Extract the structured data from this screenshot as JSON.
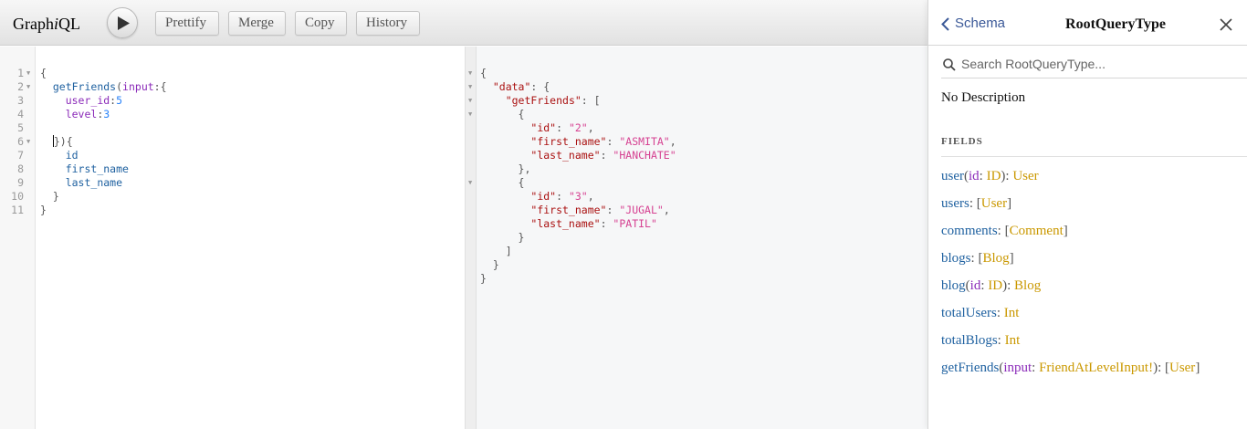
{
  "toolbar": {
    "title_prefix": "Graph",
    "title_italic": "i",
    "title_suffix": "QL",
    "run_icon": "play-icon",
    "buttons": [
      "Prettify",
      "Merge",
      "Copy",
      "History"
    ]
  },
  "query_editor": {
    "line_numbers": [
      "1",
      "2",
      "3",
      "4",
      "5",
      "6",
      "7",
      "8",
      "9",
      "10",
      "11"
    ],
    "lines": [
      {
        "indent": "",
        "tokens": [
          {
            "t": "{",
            "c": "punc"
          }
        ]
      },
      {
        "indent": "  ",
        "tokens": [
          {
            "t": "getFriends",
            "c": "fn"
          },
          {
            "t": "(",
            "c": "punc"
          },
          {
            "t": "input",
            "c": "arg"
          },
          {
            "t": ":{",
            "c": "punc"
          }
        ]
      },
      {
        "indent": "    ",
        "tokens": [
          {
            "t": "user_id",
            "c": "arg"
          },
          {
            "t": ":",
            "c": "punc"
          },
          {
            "t": "5",
            "c": "num"
          }
        ]
      },
      {
        "indent": "    ",
        "tokens": [
          {
            "t": "level",
            "c": "arg"
          },
          {
            "t": ":",
            "c": "punc"
          },
          {
            "t": "3",
            "c": "num"
          }
        ]
      },
      {
        "indent": "",
        "tokens": []
      },
      {
        "indent": "  ",
        "tokens": [
          {
            "t": "}){",
            "c": "punc"
          }
        ]
      },
      {
        "indent": "    ",
        "tokens": [
          {
            "t": "id",
            "c": "fld"
          }
        ]
      },
      {
        "indent": "    ",
        "tokens": [
          {
            "t": "first_name",
            "c": "fld"
          }
        ]
      },
      {
        "indent": "    ",
        "tokens": [
          {
            "t": "last_name",
            "c": "fld"
          }
        ]
      },
      {
        "indent": "  ",
        "tokens": [
          {
            "t": "}",
            "c": "punc"
          }
        ]
      },
      {
        "indent": "",
        "tokens": [
          {
            "t": "}",
            "c": "punc"
          }
        ]
      }
    ]
  },
  "result_viewer": {
    "lines": [
      {
        "indent": "",
        "tokens": [
          {
            "t": "{",
            "c": "punc"
          }
        ]
      },
      {
        "indent": "  ",
        "tokens": [
          {
            "t": "\"data\"",
            "c": "key"
          },
          {
            "t": ": {",
            "c": "punc"
          }
        ]
      },
      {
        "indent": "    ",
        "tokens": [
          {
            "t": "\"getFriends\"",
            "c": "key"
          },
          {
            "t": ": [",
            "c": "punc"
          }
        ]
      },
      {
        "indent": "      ",
        "tokens": [
          {
            "t": "{",
            "c": "punc"
          }
        ]
      },
      {
        "indent": "        ",
        "tokens": [
          {
            "t": "\"id\"",
            "c": "key"
          },
          {
            "t": ": ",
            "c": "punc"
          },
          {
            "t": "\"2\"",
            "c": "str"
          },
          {
            "t": ",",
            "c": "punc"
          }
        ]
      },
      {
        "indent": "        ",
        "tokens": [
          {
            "t": "\"first_name\"",
            "c": "key"
          },
          {
            "t": ": ",
            "c": "punc"
          },
          {
            "t": "\"ASMITA\"",
            "c": "str"
          },
          {
            "t": ",",
            "c": "punc"
          }
        ]
      },
      {
        "indent": "        ",
        "tokens": [
          {
            "t": "\"last_name\"",
            "c": "key"
          },
          {
            "t": ": ",
            "c": "punc"
          },
          {
            "t": "\"HANCHATE\"",
            "c": "str"
          }
        ]
      },
      {
        "indent": "      ",
        "tokens": [
          {
            "t": "},",
            "c": "punc"
          }
        ]
      },
      {
        "indent": "      ",
        "tokens": [
          {
            "t": "{",
            "c": "punc"
          }
        ]
      },
      {
        "indent": "        ",
        "tokens": [
          {
            "t": "\"id\"",
            "c": "key"
          },
          {
            "t": ": ",
            "c": "punc"
          },
          {
            "t": "\"3\"",
            "c": "str"
          },
          {
            "t": ",",
            "c": "punc"
          }
        ]
      },
      {
        "indent": "        ",
        "tokens": [
          {
            "t": "\"first_name\"",
            "c": "key"
          },
          {
            "t": ": ",
            "c": "punc"
          },
          {
            "t": "\"JUGAL\"",
            "c": "str"
          },
          {
            "t": ",",
            "c": "punc"
          }
        ]
      },
      {
        "indent": "        ",
        "tokens": [
          {
            "t": "\"last_name\"",
            "c": "key"
          },
          {
            "t": ": ",
            "c": "punc"
          },
          {
            "t": "\"PATIL\"",
            "c": "str"
          }
        ]
      },
      {
        "indent": "      ",
        "tokens": [
          {
            "t": "}",
            "c": "punc"
          }
        ]
      },
      {
        "indent": "    ",
        "tokens": [
          {
            "t": "]",
            "c": "punc"
          }
        ]
      },
      {
        "indent": "  ",
        "tokens": [
          {
            "t": "}",
            "c": "punc"
          }
        ]
      },
      {
        "indent": "",
        "tokens": [
          {
            "t": "}",
            "c": "punc"
          }
        ]
      }
    ]
  },
  "docs": {
    "back_label": "Schema",
    "title": "RootQueryType",
    "search_placeholder": "Search RootQueryType...",
    "description": "No Description",
    "fields_heading": "FIELDS",
    "fields": [
      {
        "name": "user",
        "args": [
          {
            "name": "id",
            "type": "ID"
          }
        ],
        "pre": "",
        "type": "User",
        "post": ""
      },
      {
        "name": "users",
        "args": [],
        "pre": "[",
        "type": "User",
        "post": "]"
      },
      {
        "name": "comments",
        "args": [],
        "pre": "[",
        "type": "Comment",
        "post": "]"
      },
      {
        "name": "blogs",
        "args": [],
        "pre": "[",
        "type": "Blog",
        "post": "]"
      },
      {
        "name": "blog",
        "args": [
          {
            "name": "id",
            "type": "ID"
          }
        ],
        "pre": "",
        "type": "Blog",
        "post": ""
      },
      {
        "name": "totalUsers",
        "args": [],
        "pre": "",
        "type": "Int",
        "post": ""
      },
      {
        "name": "totalBlogs",
        "args": [],
        "pre": "",
        "type": "Int",
        "post": ""
      },
      {
        "name": "getFriends",
        "args": [
          {
            "name": "input",
            "type": "FriendAtLevelInput!"
          }
        ],
        "pre": "[",
        "type": "User",
        "post": "]"
      }
    ]
  },
  "colors": {
    "field_name": "#1f61a0",
    "arg_name": "#8b2bb9",
    "type_name": "#ca9800",
    "json_key": "#aa1111",
    "json_string": "#d64292"
  }
}
